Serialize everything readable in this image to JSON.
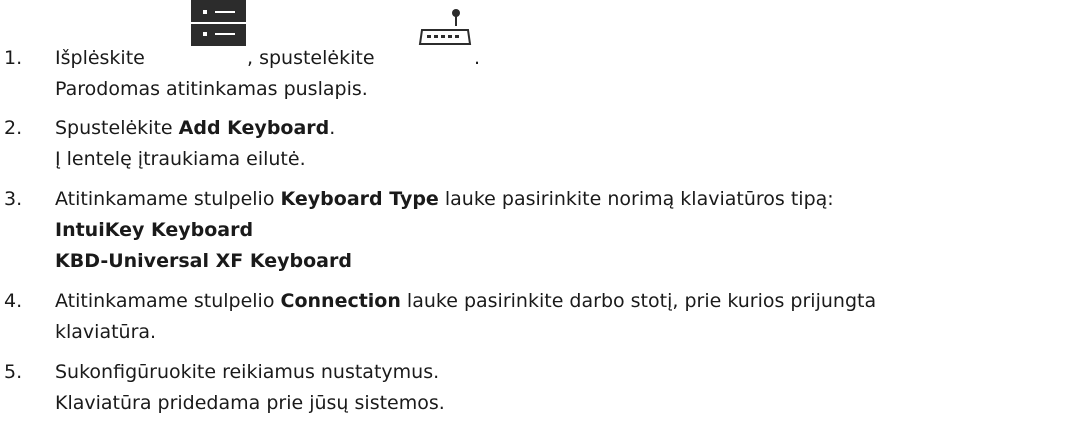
{
  "steps": [
    {
      "number": "1.",
      "segments": {
        "a": "Išplėskite",
        "b": ", spustelėkite",
        "c": "."
      },
      "icons": {
        "first": "device-tree-list-icon",
        "second": "keyboard-icon"
      },
      "result": "Parodomas atitinkamas puslapis."
    },
    {
      "number": "2.",
      "segments": {
        "a": "Spustelėkite ",
        "bold": "Add Keyboard",
        "c": "."
      },
      "result": "Į lentelę įtraukiama eilutė."
    },
    {
      "number": "3.",
      "segments": {
        "a": "Atitinkamame stulpelio ",
        "bold": "Keyboard Type",
        "c": " lauke pasirinkite norimą klaviatūros tipą:"
      },
      "options": [
        "IntuiKey Keyboard",
        "KBD-Universal XF Keyboard"
      ]
    },
    {
      "number": "4.",
      "segments": {
        "a": "Atitinkamame stulpelio ",
        "bold": "Connection",
        "c": " lauke pasirinkite darbo stotį, prie kurios prijungta"
      },
      "continuation": "klaviatūra."
    },
    {
      "number": "5.",
      "text": "Sukonfigūruokite reikiamus nustatymus.",
      "result": "Klaviatūra pridedama prie jūsų sistemos."
    }
  ],
  "colors": {
    "text": "#1a1a1a",
    "icon": "#2c2c2c"
  }
}
